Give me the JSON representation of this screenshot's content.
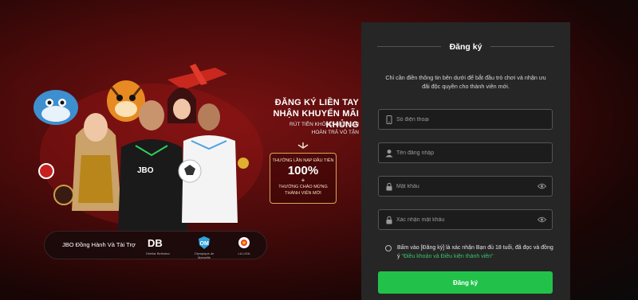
{
  "promo": {
    "headline_1": "ĐĂNG KÝ LIỀN TAY",
    "headline_2": "NHẬN KHUYẾN MÃI KHỦNG",
    "sub_1": "RÚT TIỀN KHÔNG GIỚI HẠN",
    "sub_2": "HOÀN TRẢ VÔ TẬN",
    "box_line_1": "THƯỞNG LẦN NẠP ĐẦU TIÊN",
    "box_percent": "100%",
    "box_plus": "+",
    "box_line_2": "THƯỞNG CHÀO MỪNG",
    "box_line_3": "THÀNH VIÊN MỚI",
    "shirt_brand": "JBO",
    "sponsor_text": "JBO Đồng Hành Và Tài Trợ",
    "sponsor_logos": [
      {
        "mark": "DB",
        "caption": "Dimitar Berbatov"
      },
      {
        "mark": "OM",
        "caption": "Olympique de Marseille"
      },
      {
        "mark": "LL",
        "caption": "LA LIGA"
      }
    ]
  },
  "form": {
    "title": "Đăng ký",
    "intro": "Chỉ cần điền thông tin bên dưới để bắt đầu trò chơi và nhận ưu đãi độc quyền cho thành viên mới.",
    "phone_placeholder": "Số điện thoại",
    "username_placeholder": "Tên đăng nhập",
    "password_placeholder": "Mật khẩu",
    "confirm_placeholder": "Xác nhận mật khẩu",
    "agree_text": "Bấm vào [Đăng ký] là xác nhận Bạn đủ 18 tuổi, đã đọc và đồng ý",
    "agree_link": "\"Điều khoản và Điều kiện thành viên\"",
    "submit_label": "Đăng ký"
  },
  "colors": {
    "accent_green": "#22c24a",
    "link_green": "#36c46a",
    "panel_bg": "#262626",
    "banner_red": "#7a1212"
  }
}
